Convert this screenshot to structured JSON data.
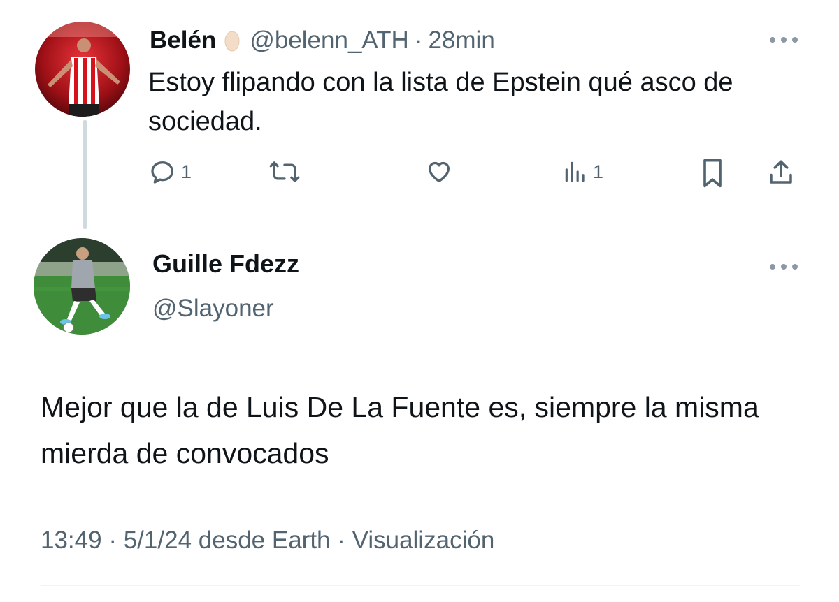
{
  "tweet1": {
    "name": "Belén",
    "name_emoji_icon": "egg-emoji-icon",
    "handle": "@belenn_ATH",
    "separator": "·",
    "time": "28min",
    "text": "Estoy flipando con la lista de Epstein qué asco de sociedad.",
    "actions": {
      "replies": "1",
      "retweets": "",
      "likes": "",
      "views": "1"
    }
  },
  "tweet2": {
    "name": "Guille Fdezz",
    "handle": "@Slayoner",
    "text": "Mejor que la de Luis De La Fuente es, siempre la misma mierda de convocados",
    "meta": {
      "time": "13:49",
      "date": "5/1/24",
      "source": "desde Earth",
      "views_label": "Visualización"
    }
  },
  "colors": {
    "text": "#0f1419",
    "muted": "#536471",
    "thread_line": "#cfd9de",
    "icon": "#536471"
  }
}
